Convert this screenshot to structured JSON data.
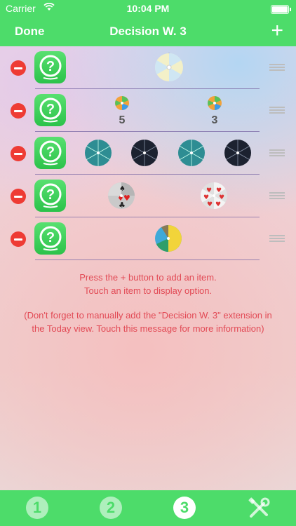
{
  "status_bar": {
    "carrier": "Carrier",
    "time": "10:04 PM"
  },
  "navbar": {
    "done_label": "Done",
    "title": "Decision W. 3",
    "add_label": "+"
  },
  "rows": [
    {
      "content": "single-wheel"
    },
    {
      "content": "two-wheels",
      "numbers": [
        "5",
        "3"
      ]
    },
    {
      "content": "four-dials"
    },
    {
      "content": "card-wheels"
    },
    {
      "content": "color-wheel"
    }
  ],
  "messages": {
    "line1": "Press the + button to add an item.",
    "line2": "Touch an item to display option.",
    "line3": "(Don't forget to manually add the \"Decision W. 3\" extension in",
    "line4": "the Today view. Touch this message for more information)"
  },
  "tabs": [
    {
      "label": "1",
      "active": false
    },
    {
      "label": "2",
      "active": false
    },
    {
      "label": "3",
      "active": true
    },
    {
      "icon": "tools-icon"
    }
  ],
  "colors": {
    "accent": "#4ddc6a",
    "delete": "#ee3b34",
    "message": "#e24a55"
  }
}
